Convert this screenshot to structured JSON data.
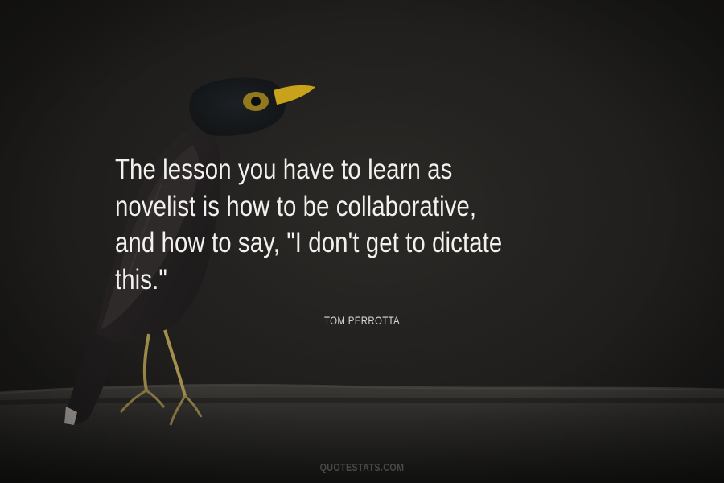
{
  "quote": {
    "lines": [
      "The lesson you have to learn as",
      "novelist is how to be collaborative,",
      "and how to say, \"I don't get to dictate",
      "this.\""
    ],
    "author": "TOM PERROTTA"
  },
  "watermark": {
    "text": "QUOTESTATS.COM"
  },
  "colors": {
    "background": "#23221f",
    "quote_text": "#f2f1ee",
    "author_text": "#d6d5d1",
    "watermark_text": "#4a4946",
    "bird_beak": "#c9a21b"
  }
}
